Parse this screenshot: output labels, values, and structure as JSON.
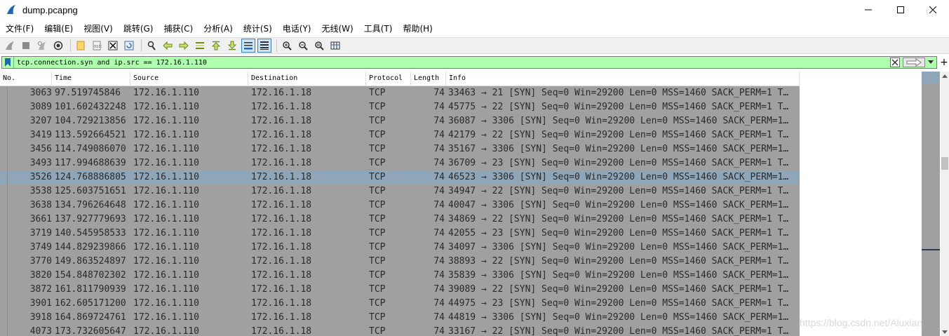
{
  "window": {
    "title": "dump.pcapng"
  },
  "menu": [
    "文件(F)",
    "编辑(E)",
    "视图(V)",
    "跳转(G)",
    "捕获(C)",
    "分析(A)",
    "统计(S)",
    "电话(Y)",
    "无线(W)",
    "工具(T)",
    "帮助(H)"
  ],
  "toolbar": {
    "buttons": [
      "shark-fin-start-icon",
      "stop-square-icon",
      "restart-fin-icon",
      "capture-options-gear-icon",
      "open-folder-icon",
      "save-file-icon",
      "close-file-icon",
      "reload-icon",
      "find-packet-icon",
      "go-back-icon",
      "go-forward-icon",
      "go-to-packet-icon",
      "go-first-icon",
      "go-last-icon",
      "autoscroll-icon",
      "colorize-icon",
      "zoom-in-icon",
      "zoom-out-icon",
      "zoom-normal-icon",
      "resize-columns-icon"
    ]
  },
  "filter": {
    "value": "tcp.connection.syn and ip.src == 172.16.1.110",
    "background": "#afffaf"
  },
  "columns": [
    "No.",
    "Time",
    "Source",
    "Destination",
    "Protocol",
    "Length",
    "Info"
  ],
  "packets": [
    {
      "no": "3063",
      "time": "97.519745846",
      "src": "172.16.1.110",
      "dst": "172.16.1.18",
      "proto": "TCP",
      "len": "74",
      "info": "33463 → 21 [SYN] Seq=0 Win=29200 Len=0 MSS=1460 SACK_PERM=1 T…"
    },
    {
      "no": "3089",
      "time": "101.602432248",
      "src": "172.16.1.110",
      "dst": "172.16.1.18",
      "proto": "TCP",
      "len": "74",
      "info": "45775 → 22 [SYN] Seq=0 Win=29200 Len=0 MSS=1460 SACK_PERM=1 T…"
    },
    {
      "no": "3207",
      "time": "104.729213856",
      "src": "172.16.1.110",
      "dst": "172.16.1.18",
      "proto": "TCP",
      "len": "74",
      "info": "36087 → 3306 [SYN] Seq=0 Win=29200 Len=0 MSS=1460 SACK_PERM=1…"
    },
    {
      "no": "3419",
      "time": "113.592664521",
      "src": "172.16.1.110",
      "dst": "172.16.1.18",
      "proto": "TCP",
      "len": "74",
      "info": "42179 → 22 [SYN] Seq=0 Win=29200 Len=0 MSS=1460 SACK_PERM=1 T…"
    },
    {
      "no": "3456",
      "time": "114.749086070",
      "src": "172.16.1.110",
      "dst": "172.16.1.18",
      "proto": "TCP",
      "len": "74",
      "info": "35167 → 3306 [SYN] Seq=0 Win=29200 Len=0 MSS=1460 SACK_PERM=1…"
    },
    {
      "no": "3493",
      "time": "117.994688639",
      "src": "172.16.1.110",
      "dst": "172.16.1.18",
      "proto": "TCP",
      "len": "74",
      "info": "36709 → 23 [SYN] Seq=0 Win=29200 Len=0 MSS=1460 SACK_PERM=1 T…"
    },
    {
      "no": "3526",
      "time": "124.768886805",
      "src": "172.16.1.110",
      "dst": "172.16.1.18",
      "proto": "TCP",
      "len": "74",
      "info": "46523 → 3306 [SYN] Seq=0 Win=29200 Len=0 MSS=1460 SACK_PERM=1…",
      "selected": true
    },
    {
      "no": "3538",
      "time": "125.603751651",
      "src": "172.16.1.110",
      "dst": "172.16.1.18",
      "proto": "TCP",
      "len": "74",
      "info": "34947 → 22 [SYN] Seq=0 Win=29200 Len=0 MSS=1460 SACK_PERM=1 T…"
    },
    {
      "no": "3638",
      "time": "134.796264648",
      "src": "172.16.1.110",
      "dst": "172.16.1.18",
      "proto": "TCP",
      "len": "74",
      "info": "40047 → 3306 [SYN] Seq=0 Win=29200 Len=0 MSS=1460 SACK_PERM=1…"
    },
    {
      "no": "3661",
      "time": "137.927779693",
      "src": "172.16.1.110",
      "dst": "172.16.1.18",
      "proto": "TCP",
      "len": "74",
      "info": "34869 → 22 [SYN] Seq=0 Win=29200 Len=0 MSS=1460 SACK_PERM=1 T…"
    },
    {
      "no": "3719",
      "time": "140.545958533",
      "src": "172.16.1.110",
      "dst": "172.16.1.18",
      "proto": "TCP",
      "len": "74",
      "info": "42055 → 23 [SYN] Seq=0 Win=29200 Len=0 MSS=1460 SACK_PERM=1 T…"
    },
    {
      "no": "3749",
      "time": "144.829239866",
      "src": "172.16.1.110",
      "dst": "172.16.1.18",
      "proto": "TCP",
      "len": "74",
      "info": "34097 → 3306 [SYN] Seq=0 Win=29200 Len=0 MSS=1460 SACK_PERM=1…"
    },
    {
      "no": "3770",
      "time": "149.863524897",
      "src": "172.16.1.110",
      "dst": "172.16.1.18",
      "proto": "TCP",
      "len": "74",
      "info": "38893 → 22 [SYN] Seq=0 Win=29200 Len=0 MSS=1460 SACK_PERM=1 T…"
    },
    {
      "no": "3820",
      "time": "154.848702302",
      "src": "172.16.1.110",
      "dst": "172.16.1.18",
      "proto": "TCP",
      "len": "74",
      "info": "35839 → 3306 [SYN] Seq=0 Win=29200 Len=0 MSS=1460 SACK_PERM=1…"
    },
    {
      "no": "3872",
      "time": "161.811790939",
      "src": "172.16.1.110",
      "dst": "172.16.1.18",
      "proto": "TCP",
      "len": "74",
      "info": "39089 → 22 [SYN] Seq=0 Win=29200 Len=0 MSS=1460 SACK_PERM=1 T…"
    },
    {
      "no": "3901",
      "time": "162.605171200",
      "src": "172.16.1.110",
      "dst": "172.16.1.18",
      "proto": "TCP",
      "len": "74",
      "info": "44975 → 23 [SYN] Seq=0 Win=29200 Len=0 MSS=1460 SACK_PERM=1 T…"
    },
    {
      "no": "3918",
      "time": "164.869724761",
      "src": "172.16.1.110",
      "dst": "172.16.1.18",
      "proto": "TCP",
      "len": "74",
      "info": "44819 → 3306 [SYN] Seq=0 Win=29200 Len=0 MSS=1460 SACK_PERM=1…"
    },
    {
      "no": "4073",
      "time": "173.732605647",
      "src": "172.16.1.110",
      "dst": "172.16.1.18",
      "proto": "TCP",
      "len": "74",
      "info": "33167 → 22 [SYN] Seq=0 Win=29200 Len=0 MSS=1460 SACK_PERM=1 T…"
    }
  ],
  "colors": {
    "row_bg": "#a0a0a0",
    "selected_row_bg": "#8ea6b8",
    "filter_ok": "#afffaf"
  },
  "watermark": "https://blog.csdn.net/Aluxian"
}
